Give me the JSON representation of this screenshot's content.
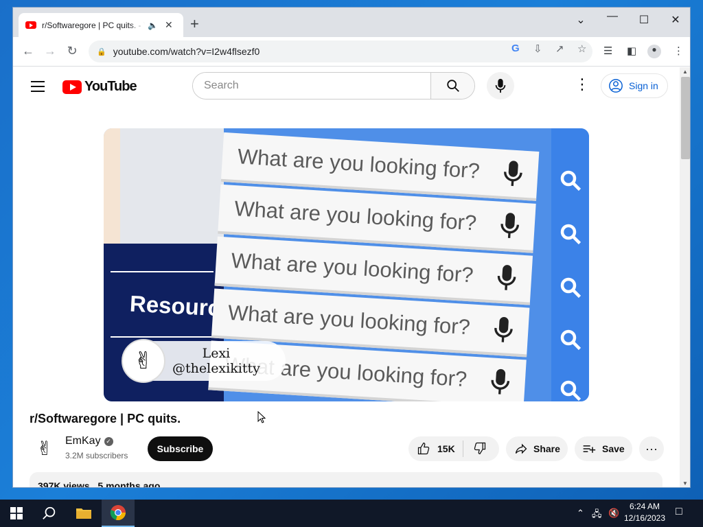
{
  "browser": {
    "tab_title": "r/Softwaregore | PC quits. - YouTube",
    "url": "youtube.com/watch?v=I2w4flsezf0"
  },
  "youtube": {
    "logo_text": "YouTube",
    "search_placeholder": "Search",
    "signin_label": "Sign in"
  },
  "video": {
    "thumbnail_query_text": "What are you looking for?",
    "overlay_text_resource": "Resourc",
    "watermark_name": "Lexi",
    "watermark_handle": "@thelexikitty",
    "title": "r/Softwaregore | PC quits.",
    "channel_name": "EmKay",
    "subscribers": "3.2M subscribers",
    "subscribe_label": "Subscribe",
    "like_count": "15K",
    "share_label": "Share",
    "save_label": "Save",
    "views": "397K views",
    "upload_age": "5 months ago"
  },
  "taskbar": {
    "time": "6:24 AM",
    "date": "12/16/2023"
  },
  "colors": {
    "yt_red": "#ff0000",
    "link_blue": "#065fd4",
    "desktop_blue": "#1b7fd8"
  }
}
